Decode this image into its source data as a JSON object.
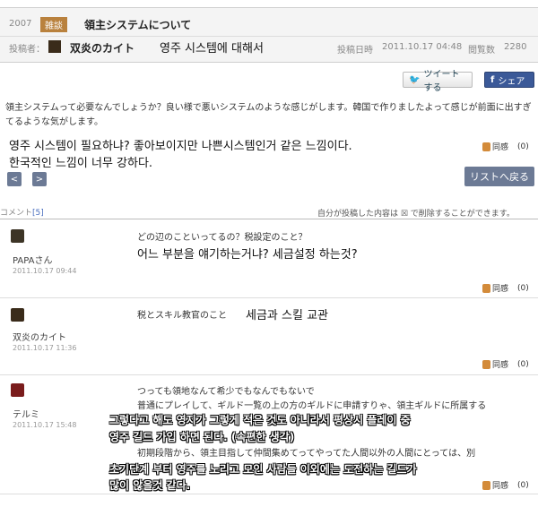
{
  "header": {
    "year": "2007",
    "category_badge": "雑談",
    "title": "領主システムについて",
    "poster_label": "投稿者：",
    "poster_name": "双炎のカイト",
    "title_kr": "영주 시스템에 대해서",
    "date_label": "投稿日時",
    "date_value": "2011.10.17 04:48",
    "views_label": "閲覧数",
    "views_value": "2280"
  },
  "share": {
    "tweet_label": "ツイートする",
    "facebook_label": "シェア"
  },
  "post": {
    "body_jp": "領主システムって必要なんでしょうか？良い様で悪いシステムのような感じがします。韓国で作りましたよって感じが前面に出すぎてるような気がします。",
    "body_kr_1": "영주 시스템이 필요하냐? 좋아보이지만 나쁜시스템인거 같은 느낌이다.",
    "body_kr_2": "한국적인 느낌이 너무 강하다.",
    "like_label": "同感",
    "like_count": "(0)"
  },
  "nav": {
    "prev_symbol": "<",
    "next_symbol": ">",
    "list_back_label": "リストへ戻る"
  },
  "comments_header": {
    "label": "コメント",
    "count": "[5]",
    "note": "自分が投稿した内容は ☒ で削除することができます。"
  },
  "comments": [
    {
      "author": "PAPAさん",
      "date": "2011.10.17 09:44",
      "text_jp": "どの辺のこといってるの？税設定のこと？",
      "text_kr": "어느 부분을 얘기하는거냐? 세금설정 하는것?",
      "like_label": "同感",
      "like_count": "(0)",
      "avatar_color": "#3d3526"
    },
    {
      "author": "双炎のカイト",
      "date": "2011.10.17 11:36",
      "text_jp": "税とスキル教官のこと",
      "text_kr": "세금과 스킬 교관",
      "like_label": "同感",
      "like_count": "(0)",
      "avatar_color": "#3a2b1a"
    },
    {
      "author": "テルミ",
      "date": "2011.10.17 15:48",
      "text_jp_1": "つっても領地なんて希少でもなんでもないで",
      "text_jp_2": "普通にプレイして、ギルド一覧の上の方のギルドに申請すりゃ、領主ギルドに所属する",
      "text_jp_3": "初期段階から、領主目指して仲間集めてってやってた人間以外の人間にとっては、別",
      "overlay_kr_1": "그렇다고 해도 영지가 그렇게 적은 것도 아니라서 평상시 플레이 중",
      "overlay_kr_2": "영주 길드 가입 하면 된다. (속편한 생각)",
      "overlay_kr_3": "초기단계 부터 영주를 노리고 모인 사람들 이외에는 도전하는 길드가",
      "overlay_kr_4": "많이 않을것 같다.",
      "like_label": "同感",
      "like_count": "(0)",
      "avatar_color": "#7a1c1c"
    }
  ]
}
